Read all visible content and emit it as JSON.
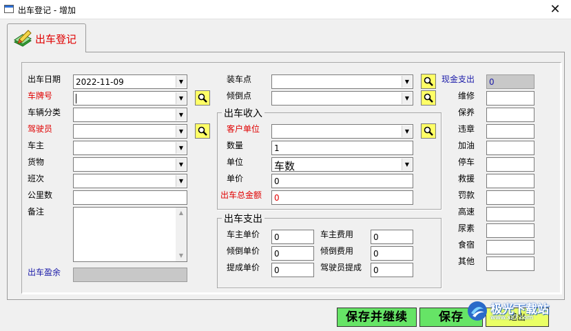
{
  "window": {
    "title": "出车登记 - 增加",
    "close_glyph": "✕"
  },
  "tab": {
    "label": "出车登记",
    "icon": "edit-pencil-icon"
  },
  "left": {
    "fields": [
      {
        "label": "出车日期",
        "value": "2022-11-09",
        "color": "black"
      },
      {
        "label": "车牌号",
        "value": "",
        "color": "red"
      },
      {
        "label": "车辆分类",
        "value": "",
        "color": "black"
      },
      {
        "label": "驾驶员",
        "value": "",
        "color": "red"
      },
      {
        "label": "车主",
        "value": "",
        "color": "black"
      },
      {
        "label": "货物",
        "value": "",
        "color": "black"
      },
      {
        "label": "班次",
        "value": "",
        "color": "black"
      },
      {
        "label": "公里数",
        "value": "",
        "color": "black"
      },
      {
        "label": "备注",
        "value": "",
        "color": "black"
      }
    ],
    "profit": {
      "label": "出车盈余",
      "value": ""
    }
  },
  "middle": {
    "loading_point": {
      "label": "装车点",
      "value": ""
    },
    "unloading_point": {
      "label": "倾倒点",
      "value": ""
    },
    "income": {
      "title": "出车收入",
      "customer": {
        "label": "客户单位",
        "value": ""
      },
      "quantity": {
        "label": "数量",
        "value": "1"
      },
      "unit": {
        "label": "单位",
        "value": "车数"
      },
      "price": {
        "label": "单价",
        "value": "0"
      },
      "total": {
        "label": "出车总金额",
        "value": "0"
      }
    },
    "expense": {
      "title": "出车支出",
      "owner_price": {
        "label": "车主单价",
        "value": "0"
      },
      "owner_fee": {
        "label": "车主费用",
        "value": "0"
      },
      "dump_price": {
        "label": "倾倒单价",
        "value": "0"
      },
      "dump_fee": {
        "label": "倾倒费用",
        "value": "0"
      },
      "commission_price": {
        "label": "提成单价",
        "value": "0"
      },
      "driver_commission": {
        "label": "驾驶员提成",
        "value": "0"
      }
    }
  },
  "right": {
    "cash": {
      "label": "现金支出",
      "value": "0"
    },
    "items": [
      {
        "label": "维修",
        "value": ""
      },
      {
        "label": "保养",
        "value": ""
      },
      {
        "label": "违章",
        "value": ""
      },
      {
        "label": "加油",
        "value": ""
      },
      {
        "label": "停车",
        "value": ""
      },
      {
        "label": "救援",
        "value": ""
      },
      {
        "label": "罚款",
        "value": ""
      },
      {
        "label": "高速",
        "value": ""
      },
      {
        "label": "尿素",
        "value": ""
      },
      {
        "label": "食宿",
        "value": ""
      },
      {
        "label": "其他",
        "value": ""
      }
    ]
  },
  "buttons": {
    "save_continue": "保存并继续",
    "save": "保存",
    "exit": "退出"
  },
  "watermark": {
    "text": "极光下载站",
    "sub": "www.xz7.com"
  },
  "colors": {
    "required_label": "#e00000",
    "summary_label": "#1a1aa8",
    "search_button": "#ffff66",
    "save_button": "#66e466",
    "exit_button": "#eaff66"
  }
}
